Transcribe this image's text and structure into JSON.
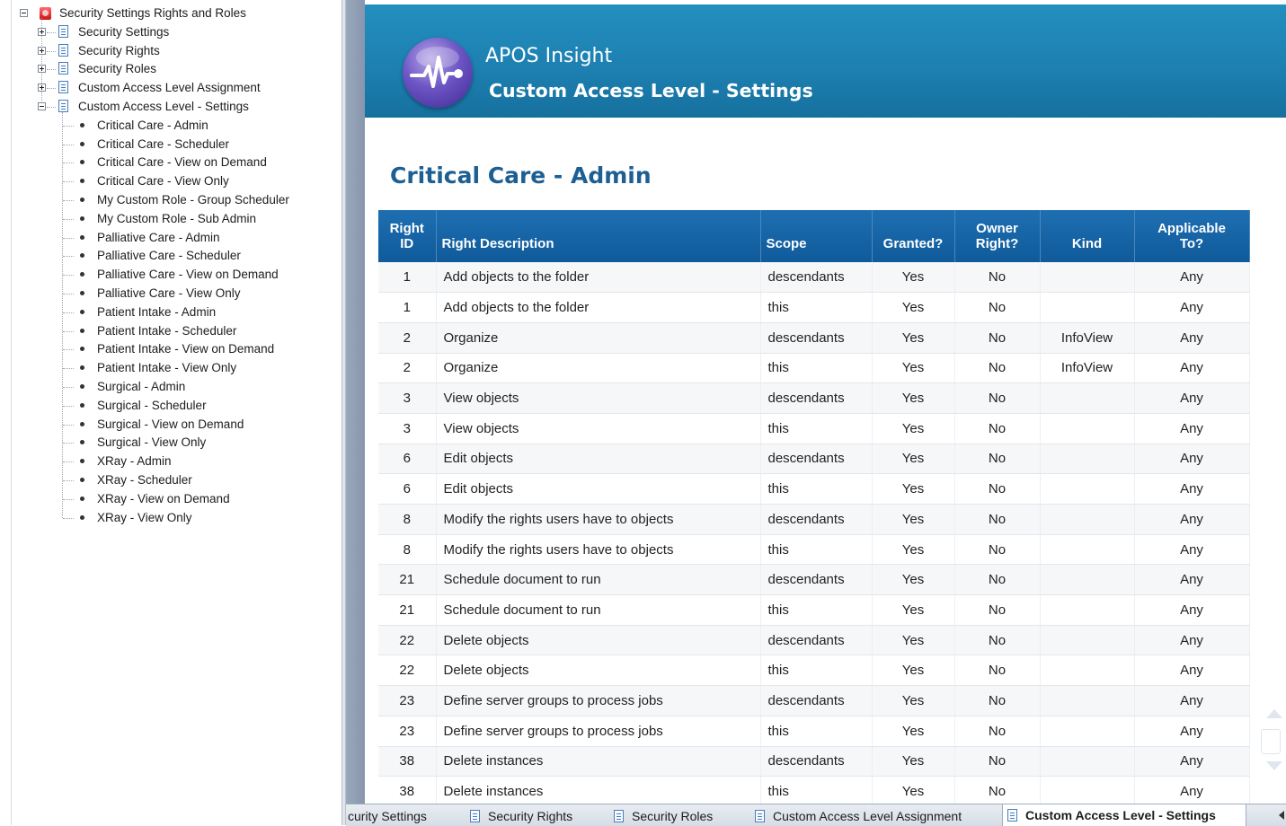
{
  "tree": {
    "root": "Security Settings Rights and Roles",
    "folders": [
      {
        "label": "Security Settings",
        "expanded": false
      },
      {
        "label": "Security Rights",
        "expanded": false
      },
      {
        "label": "Security Roles",
        "expanded": false
      },
      {
        "label": "Custom Access Level Assignment",
        "expanded": false
      },
      {
        "label": "Custom Access Level - Settings",
        "expanded": true
      }
    ],
    "leaves": [
      "Critical Care - Admin",
      "Critical Care - Scheduler",
      "Critical Care - View on Demand",
      "Critical Care - View Only",
      "My Custom Role - Group Scheduler",
      "My Custom Role - Sub Admin",
      "Palliative Care - Admin",
      "Palliative Care - Scheduler",
      "Palliative Care - View on Demand",
      "Palliative Care - View Only",
      "Patient Intake - Admin",
      "Patient Intake - Scheduler",
      "Patient Intake - View on Demand",
      "Patient Intake - View Only",
      "Surgical - Admin",
      "Surgical - Scheduler",
      "Surgical - View on Demand",
      "Surgical - View Only",
      "XRay - Admin",
      "XRay - Scheduler",
      "XRay - View on Demand",
      "XRay - View Only"
    ]
  },
  "banner": {
    "app_name": "APOS Insight",
    "subtitle": "Custom Access Level - Settings"
  },
  "report": {
    "title": "Critical Care - Admin",
    "columns": {
      "right_id": [
        "Right",
        "ID"
      ],
      "description": "Right Description",
      "scope": "Scope",
      "granted": "Granted?",
      "owner": [
        "Owner",
        "Right?"
      ],
      "kind": "Kind",
      "applicable": [
        "Applicable",
        "To?"
      ]
    },
    "rows": [
      [
        "1",
        "Add objects to the folder",
        "descendants",
        "Yes",
        "No",
        "",
        "Any"
      ],
      [
        "1",
        "Add objects to the folder",
        "this",
        "Yes",
        "No",
        "",
        "Any"
      ],
      [
        "2",
        "Organize",
        "descendants",
        "Yes",
        "No",
        "InfoView",
        "Any"
      ],
      [
        "2",
        "Organize",
        "this",
        "Yes",
        "No",
        "InfoView",
        "Any"
      ],
      [
        "3",
        "View objects",
        "descendants",
        "Yes",
        "No",
        "",
        "Any"
      ],
      [
        "3",
        "View objects",
        "this",
        "Yes",
        "No",
        "",
        "Any"
      ],
      [
        "6",
        "Edit objects",
        "descendants",
        "Yes",
        "No",
        "",
        "Any"
      ],
      [
        "6",
        "Edit objects",
        "this",
        "Yes",
        "No",
        "",
        "Any"
      ],
      [
        "8",
        "Modify the rights users have to objects",
        "descendants",
        "Yes",
        "No",
        "",
        "Any"
      ],
      [
        "8",
        "Modify the rights users have to objects",
        "this",
        "Yes",
        "No",
        "",
        "Any"
      ],
      [
        "21",
        "Schedule document to run",
        "descendants",
        "Yes",
        "No",
        "",
        "Any"
      ],
      [
        "21",
        "Schedule document to run",
        "this",
        "Yes",
        "No",
        "",
        "Any"
      ],
      [
        "22",
        "Delete objects",
        "descendants",
        "Yes",
        "No",
        "",
        "Any"
      ],
      [
        "22",
        "Delete objects",
        "this",
        "Yes",
        "No",
        "",
        "Any"
      ],
      [
        "23",
        "Define server groups to process jobs",
        "descendants",
        "Yes",
        "No",
        "",
        "Any"
      ],
      [
        "23",
        "Define server groups to process jobs",
        "this",
        "Yes",
        "No",
        "",
        "Any"
      ],
      [
        "38",
        "Delete instances",
        "descendants",
        "Yes",
        "No",
        "",
        "Any"
      ],
      [
        "38",
        "Delete instances",
        "this",
        "Yes",
        "No",
        "",
        "Any"
      ]
    ]
  },
  "tabs": [
    {
      "label": "curity Settings",
      "active": false,
      "icon": "document-icon"
    },
    {
      "label": "Security Rights",
      "active": false,
      "icon": "document-icon"
    },
    {
      "label": "Security Roles",
      "active": false,
      "icon": "document-icon"
    },
    {
      "label": "Custom Access Level Assignment",
      "active": false,
      "icon": "document-icon"
    },
    {
      "label": "Custom Access Level - Settings",
      "active": true,
      "icon": "document-icon"
    }
  ],
  "colors": {
    "banner": "#1c7fb0",
    "header_row": "#15619f",
    "title": "#1d5f92"
  }
}
